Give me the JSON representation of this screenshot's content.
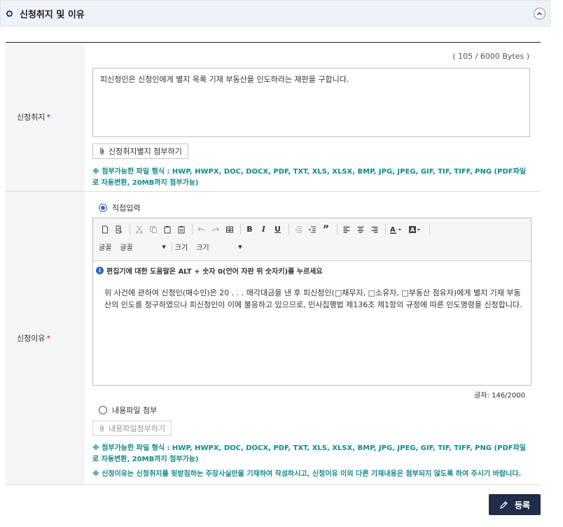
{
  "header": {
    "title": "신청취지 및 이유"
  },
  "purpose": {
    "label": "신청취지",
    "required_mark": "*",
    "byte_count": "( 105 / 6000 Bytes )",
    "text": "피신청인은 신청인에게 별지 목록 기재 부동산을 인도하라는 재판을 구합니다.",
    "attach_label": "신청취지별지 첨부하기",
    "file_note": "※ 첨부가능한 파일 형식 : HWP, HWPX, DOC, DOCX, PDF, TXT, XLS, XLSX, BMP, JPG, JPEG, GIF, TIF, TIFF, PNG (PDF파일로 자동변환, 20MB까지 첨부가능)"
  },
  "reason": {
    "label": "신청이유",
    "required_mark": "*",
    "direct_input_label": "직접입력",
    "direct_input_selected": true,
    "toolbar": {
      "font_label": "글꼴",
      "font_value": "글꼴",
      "size_label": "크기",
      "size_value": "크기"
    },
    "help_text": "편집기에 대한 도움말은 ALT + 숫자 0(언어 자판 위 숫자키)를 누르세요",
    "body_text": "위 사건에 관하여 신청인(매수인)은 20 . . . 매각대금을 낸 후 피신청인(□채무자, □소유자, □부동산 점유자)에게 별지 기재 부동산의 인도를 청구하였으나 피신청인이 이에 불응하고 있으므로, 민사집행법 제136조 제1항의 규정에 따른 인도명령을 신청합니다.",
    "char_count": "글자: 146/2000",
    "file_attach_label": "내용파일 첨부",
    "file_attach_button": "내용파일첨부하기",
    "file_note": "※ 첨부가능한 파일 형식 : HWP, HWPX, DOC, DOCX, PDF, TXT, XLS, XLSX, BMP, JPG, JPEG, GIF, TIF, TIFF, PNG (PDF파일로 자동변환, 20MB까지 첨부가능)",
    "reason_note": "※ 신청이유는 신청취지를 뒷받침하는 주장사실만을 기재하여 작성하시고, 신청이유 이외 다른 기재내용은 첨부되지 않도록 하여 주시기 바랍니다."
  },
  "actions": {
    "submit_label": "등록"
  },
  "colors": {
    "header_bg": "#eef2f9",
    "accent_teal": "#138a8a",
    "submit_bg": "#1f2d48",
    "required_red": "#d0021b"
  }
}
